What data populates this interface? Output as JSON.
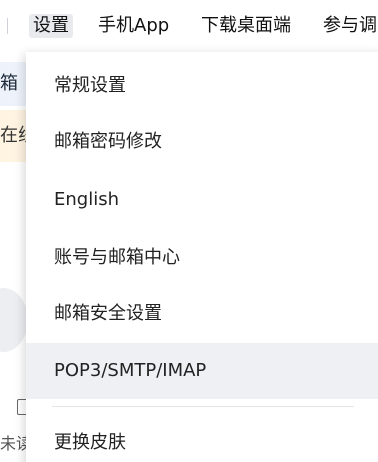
{
  "topbar": {
    "items": [
      {
        "label": "设置"
      },
      {
        "label": "手机App"
      },
      {
        "label": "下载桌面端"
      },
      {
        "label": "参与调"
      }
    ]
  },
  "background": {
    "tab_fragment": "箱",
    "banner_fragment": "在线解",
    "unread_fragment": "未读"
  },
  "menu": {
    "items": [
      {
        "label": "常规设置"
      },
      {
        "label": "邮箱密码修改"
      },
      {
        "label": "English"
      },
      {
        "label": "账号与邮箱中心"
      },
      {
        "label": "邮箱安全设置"
      },
      {
        "label": "POP3/SMTP/IMAP"
      },
      {
        "label": "更换皮肤"
      }
    ]
  }
}
